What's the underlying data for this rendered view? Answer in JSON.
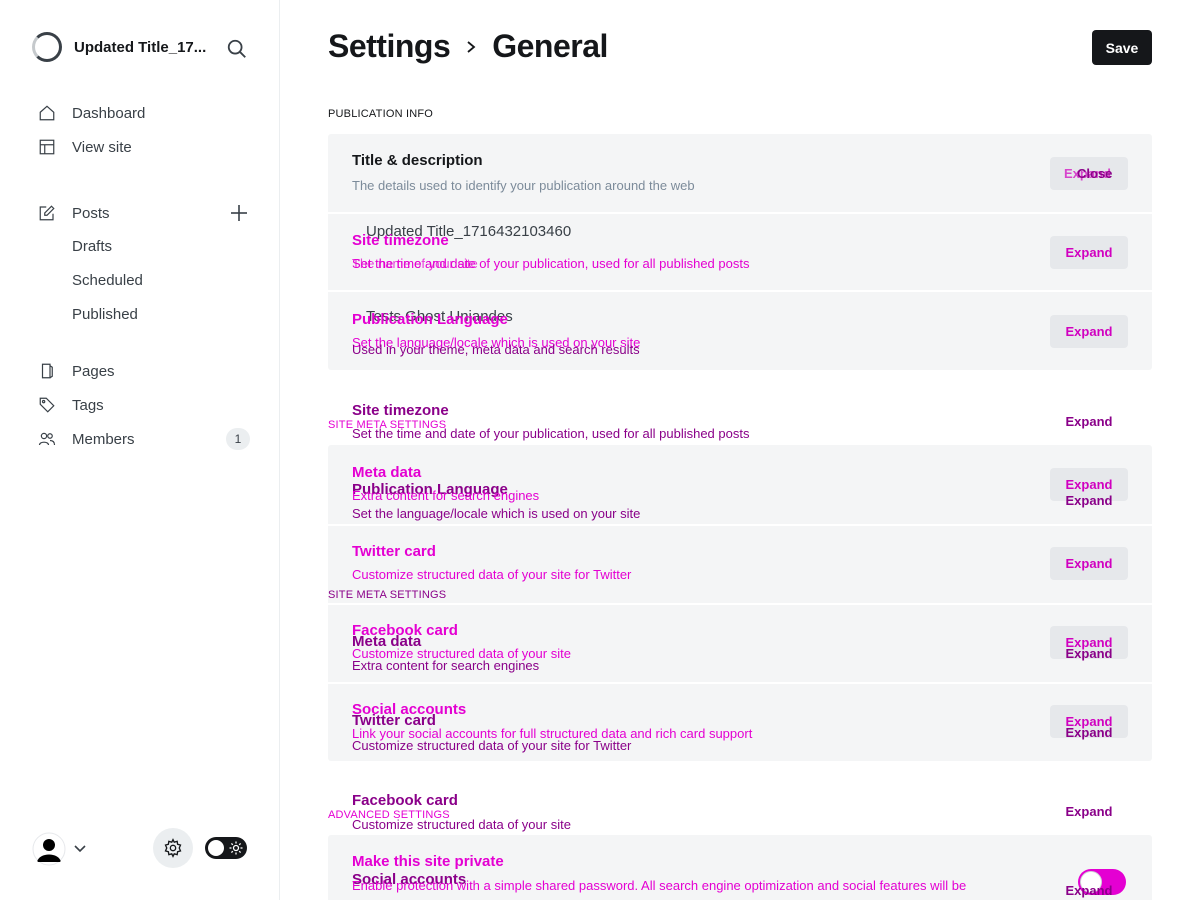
{
  "sidebar": {
    "site_title": "Updated Title_17...",
    "nav": {
      "dashboard": "Dashboard",
      "view_site": "View site",
      "posts": "Posts",
      "drafts": "Drafts",
      "scheduled": "Scheduled",
      "published": "Published",
      "pages": "Pages",
      "tags": "Tags",
      "members": "Members",
      "members_count": "1"
    },
    "icons": [
      "search-icon",
      "home-icon",
      "layout-icon",
      "edit-icon",
      "plus-icon",
      "page-icon",
      "tag-icon",
      "members-icon",
      "user-icon",
      "chevron-down-icon",
      "gear-icon",
      "sun-icon"
    ]
  },
  "header": {
    "breadcrumb_parent": "Settings",
    "breadcrumb_current": "General",
    "save_label": "Save"
  },
  "sections": {
    "publication_info": "PUBLICATION INFO",
    "site_meta": "SITE META SETTINGS",
    "advanced": "ADVANCED SETTINGS"
  },
  "rows": {
    "title_desc": {
      "title": "Title & description",
      "desc": "The details used to identify your publication around the web",
      "btn_expand": "Expand",
      "btn_close": "Close",
      "title_value": "Updated Title_1716432103460",
      "title_hint": "The name of your site",
      "desc_value": "Tests Ghost Uniandes",
      "desc_hint": "Used in your theme, meta data and search results"
    },
    "timezone": {
      "title": "Site timezone",
      "desc": "Set the time and date of your publication, used for all published posts",
      "btn": "Expand"
    },
    "language": {
      "title": "Publication Language",
      "desc": "Set the language/locale which is used on your site",
      "btn": "Expand"
    },
    "meta_data": {
      "title": "Meta data",
      "desc": "Extra content for search engines",
      "btn": "Expand"
    },
    "twitter": {
      "title": "Twitter card",
      "desc": "Customize structured data of your site for Twitter",
      "btn": "Expand"
    },
    "facebook": {
      "title": "Facebook card",
      "desc": "Customize structured data of your site",
      "btn": "Expand"
    },
    "social": {
      "title": "Social accounts",
      "desc": "Link your social accounts for full structured data and rich card support",
      "btn": "Expand"
    },
    "private": {
      "title": "Make this site private",
      "desc": "Enable protection with a simple shared password. All search engine optimization and social features will be"
    }
  },
  "colors": {
    "accent": "#15171a",
    "overlay_magenta": "#e400d2",
    "overlay_dark": "#8a0089",
    "panel": "#f4f5f6"
  }
}
